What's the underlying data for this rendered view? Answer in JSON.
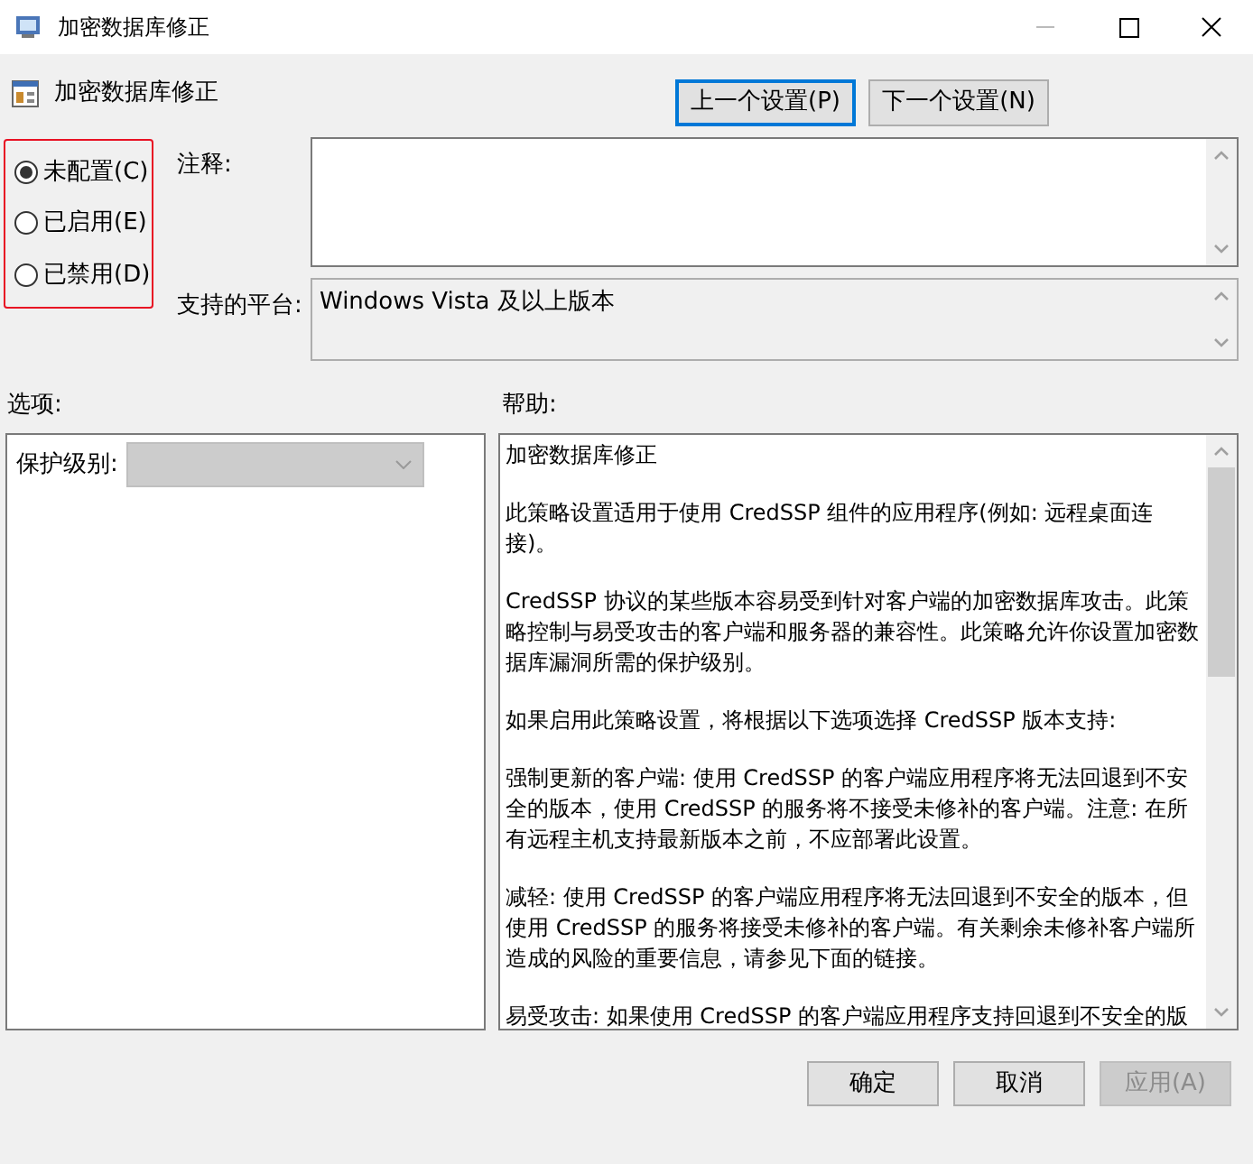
{
  "window": {
    "title": "加密数据库修正"
  },
  "header": {
    "title": "加密数据库修正"
  },
  "nav_buttons": [
    {
      "label": "上一个设置(P)",
      "focused": true
    },
    {
      "label": "下一个设置(N)",
      "focused": false
    }
  ],
  "state_options": [
    {
      "label": "未配置(C)",
      "selected": true
    },
    {
      "label": "已启用(E)",
      "selected": false
    },
    {
      "label": "已禁用(D)",
      "selected": false
    }
  ],
  "comment": {
    "label": "注释:"
  },
  "platform": {
    "label": "支持的平台:",
    "value": "Windows Vista 及以上版本"
  },
  "options": {
    "label": "选项:",
    "fields": [
      {
        "label": "保护级别:",
        "disabled": true
      }
    ]
  },
  "help": {
    "label": "帮助:",
    "paragraphs": [
      "加密数据库修正",
      "此策略设置适用于使用 CredSSP 组件的应用程序(例如: 远程桌面连接)。",
      "CredSSP 协议的某些版本容易受到针对客户端的加密数据库攻击。此策略控制与易受攻击的客户端和服务器的兼容性。此策略允许你设置加密数据库漏洞所需的保护级别。",
      "如果启用此策略设置，将根据以下选项选择 CredSSP 版本支持:",
      "强制更新的客户端: 使用 CredSSP 的客户端应用程序将无法回退到不安全的版本，使用 CredSSP 的服务将不接受未修补的客户端。注意: 在所有远程主机支持最新版本之前，不应部署此设置。",
      "减轻: 使用 CredSSP 的客户端应用程序将无法回退到不安全的版本，但使用 CredSSP 的服务将接受未修补的客户端。有关剩余未修补客户端所造成的风险的重要信息，请参见下面的链接。",
      "易受攻击: 如果使用 CredSSP 的客户端应用程序支持回退到不安全的版"
    ]
  },
  "footer_buttons": [
    {
      "label": "确定",
      "disabled": false
    },
    {
      "label": "取消",
      "disabled": false
    },
    {
      "label": "应用(A)",
      "disabled": true
    }
  ]
}
